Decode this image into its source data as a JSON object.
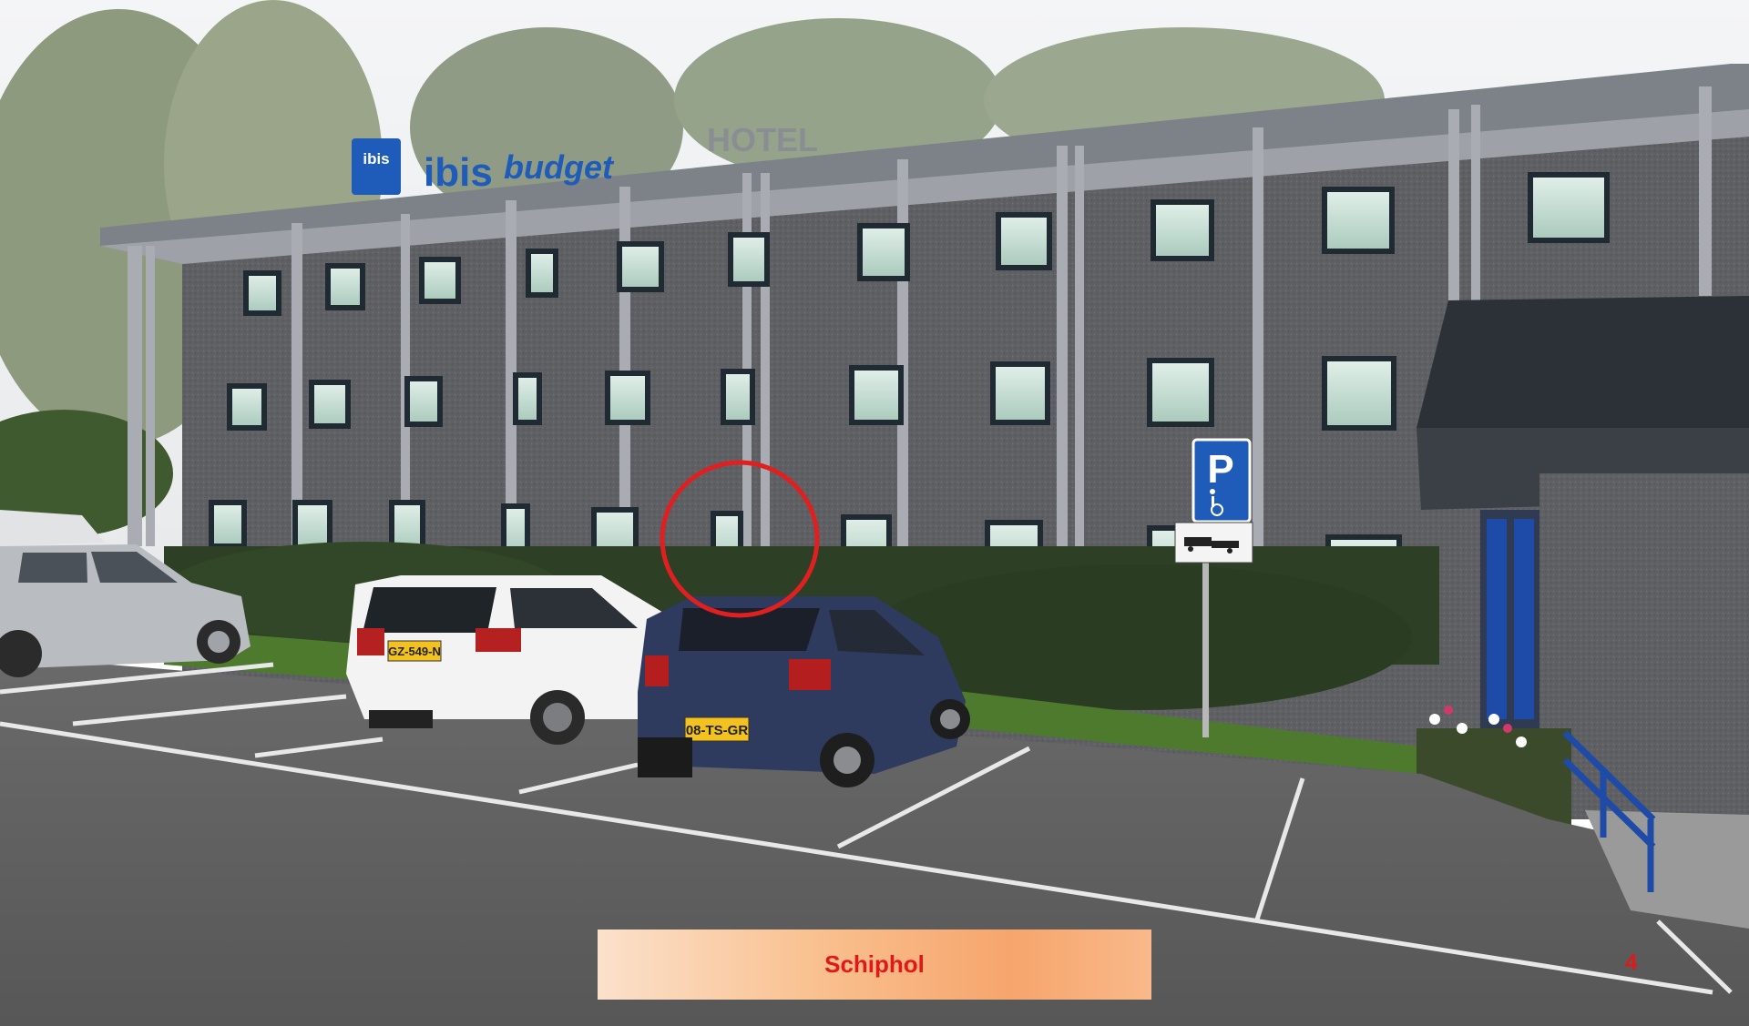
{
  "photo": {
    "hotel_brand": "ibis",
    "hotel_brand_sub": "budget",
    "hotel_word": "HOTEL",
    "plate_white_car": "GZ-549-N",
    "plate_blue_car": "08-TS-GR",
    "parking_sign_letter": "P"
  },
  "caption": {
    "text": "Schiphol"
  },
  "page": {
    "number": "4"
  },
  "colors": {
    "caption_text": "#e01818",
    "ibis_blue": "#1f5bb8",
    "highlight_circle": "#e02020"
  },
  "icons": [
    "wheelchair-icon",
    "tow-truck-icon"
  ]
}
